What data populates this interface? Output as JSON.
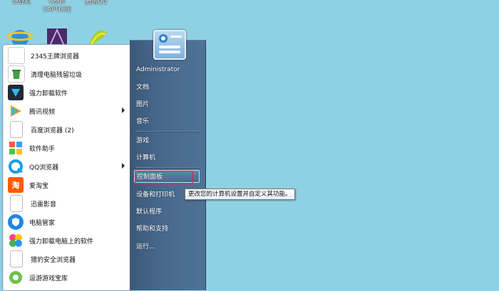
{
  "desktop": {
    "icons": [
      {
        "label": "计算机"
      },
      {
        "label": "Corel\nCAPTURE"
      },
      {
        "label": "腾讯QQ"
      }
    ]
  },
  "start_menu": {
    "left_items": [
      {
        "label": "2345王牌浏览器",
        "icon": "browser-2345-icon",
        "has_submenu": false
      },
      {
        "label": "清理电脑残留垃圾",
        "icon": "recycle-icon",
        "has_submenu": false
      },
      {
        "label": "强力卸载软件",
        "icon": "uninstall-icon",
        "has_submenu": false
      },
      {
        "label": "腾讯视频",
        "icon": "tencent-video-icon",
        "has_submenu": true
      },
      {
        "label": "百度浏览器 (2)",
        "icon": "document-icon",
        "has_submenu": false
      },
      {
        "label": "软件助手",
        "icon": "apps-grid-icon",
        "has_submenu": false
      },
      {
        "label": "QQ浏览器",
        "icon": "qq-browser-icon",
        "has_submenu": true
      },
      {
        "label": "爱淘宝",
        "icon": "taobao-icon",
        "has_submenu": false
      },
      {
        "label": "迅雷影音",
        "icon": "document-icon",
        "has_submenu": false
      },
      {
        "label": "电脑管家",
        "icon": "shield-icon",
        "has_submenu": false
      },
      {
        "label": "强力卸载电脑上的软件",
        "icon": "colorful-leaf-icon",
        "has_submenu": false
      },
      {
        "label": "猎豹安全浏览器",
        "icon": "document-icon",
        "has_submenu": false
      },
      {
        "label": "逗游游戏宝库",
        "icon": "game-icon",
        "has_submenu": false
      }
    ],
    "right_items": [
      {
        "label": "Administrator"
      },
      {
        "label": "文档"
      },
      {
        "label": "图片"
      },
      {
        "label": "音乐"
      },
      {
        "label": "游戏"
      },
      {
        "label": "计算机"
      },
      {
        "label": "控制面板"
      },
      {
        "label": "设备和打印机"
      },
      {
        "label": "默认程序"
      },
      {
        "label": "帮助和支持"
      },
      {
        "label": "运行..."
      }
    ],
    "tooltip": "更改您的计算机设置并自定义其功能。"
  },
  "colors": {
    "desktop": "#8fd1e4",
    "right_panel": "#47688c",
    "highlight_box": "#e0283c"
  }
}
